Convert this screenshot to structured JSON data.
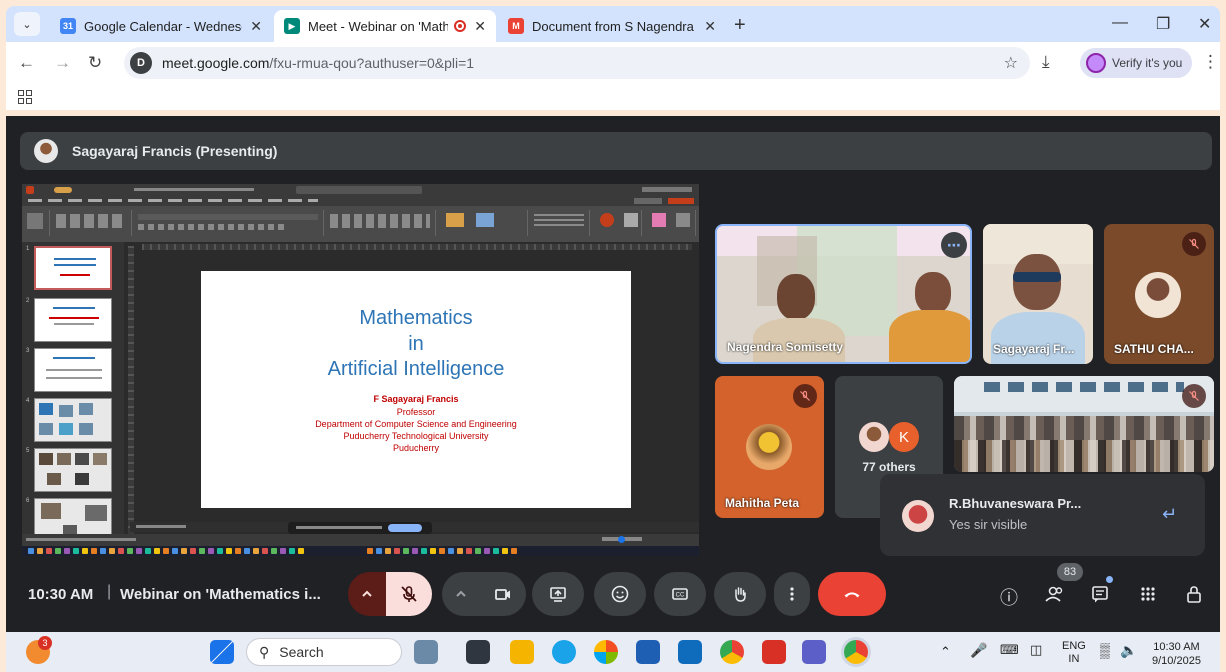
{
  "browser": {
    "tabs": [
      {
        "title": "Google Calendar - Wednesday,",
        "active": false
      },
      {
        "title": "Meet - Webinar on 'Mathem",
        "active": true
      },
      {
        "title": "Document from S Nagendra - s",
        "active": false
      }
    ],
    "new_tab": "+",
    "url_host": "meet.google.com",
    "url_path": "/fxu-rmua-qou?authuser=0&pli=1",
    "verify_label": "Verify it's you"
  },
  "meet": {
    "presenter_bar": "Sagayaraj Francis (Presenting)",
    "slide": {
      "title_lines": [
        "Mathematics",
        "in",
        "Artificial Intelligence"
      ],
      "presenter": "F Sagayaraj Francis",
      "lines": [
        "Professor",
        "Department of Computer Science and Engineering",
        "Puducherry Technological University",
        "Puducherry"
      ]
    },
    "participants": [
      {
        "name": "Nagendra Somisetty",
        "muted": false
      },
      {
        "name": "Sagayaraj Fr...",
        "muted": false
      },
      {
        "name": "SATHU CHA...",
        "muted": true
      },
      {
        "name": "Mahitha Peta",
        "muted": true
      },
      {
        "name": "77 others",
        "avatar_letter": "K"
      }
    ],
    "notification": {
      "sender": "R.Bhuvaneswara Pr...",
      "message": "Yes sir visible"
    },
    "bottom": {
      "time": "10:30 AM",
      "separator": "|",
      "meeting_title": "Webinar on 'Mathematics i...",
      "people_count": "83"
    }
  },
  "taskbar": {
    "search_label": "Search",
    "lang_top": "ENG",
    "lang_bottom": "IN",
    "time": "10:30 AM",
    "date": "9/10/2025",
    "notification_count": "3"
  },
  "colors": {
    "meet_bg": "#202124",
    "end_call": "#ea4335",
    "slide_title": "#2e75b6",
    "slide_red": "#c00000"
  }
}
